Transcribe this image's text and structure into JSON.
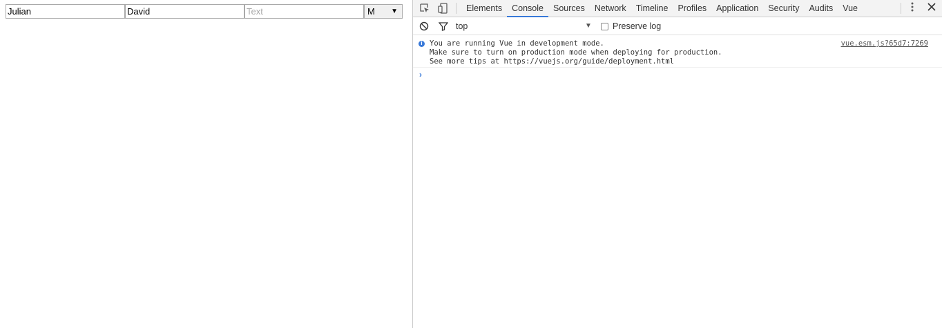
{
  "page": {
    "first_name_value": "Julian",
    "last_name_value": "David",
    "text_placeholder": "Text",
    "select_value": "M",
    "select_arrow": "▼"
  },
  "devtools": {
    "tabs": [
      "Elements",
      "Console",
      "Sources",
      "Network",
      "Timeline",
      "Profiles",
      "Application",
      "Security",
      "Audits",
      "Vue"
    ],
    "active_tab": "Console",
    "icons": [
      "inspect-icon",
      "device-toggle-icon",
      "more-icon",
      "close-icon",
      "clear-console-icon",
      "filter-icon"
    ],
    "accent_color": "#3879d9",
    "console": {
      "context": "top",
      "context_arrow": "▼",
      "preserve_log_label": "Preserve log",
      "preserve_log_checked": false,
      "message_lines": "You are running Vue in development mode.\nMake sure to turn on production mode when deploying for production.\nSee more tips at https://vuejs.org/guide/deployment.html",
      "message_source": "vue.esm.js?65d7:7269",
      "prompt_symbol": "›"
    }
  }
}
